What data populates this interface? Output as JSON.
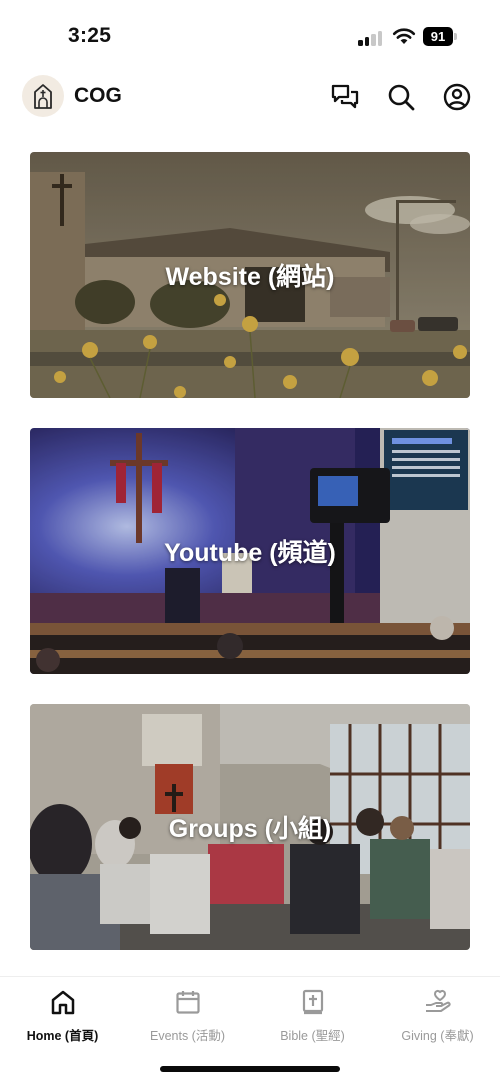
{
  "status_bar": {
    "time": "3:25",
    "battery": "91"
  },
  "header": {
    "title": "COG",
    "icons": [
      "church-logo-icon",
      "chat-icon",
      "search-icon",
      "account-icon"
    ]
  },
  "cards": [
    {
      "label": "Website (網站)",
      "name": "website"
    },
    {
      "label": "Youtube (頻道)",
      "name": "youtube"
    },
    {
      "label": "Groups (小組)",
      "name": "groups"
    }
  ],
  "tabs": [
    {
      "label": "Home (首頁)",
      "icon": "home-icon",
      "active": true
    },
    {
      "label": "Events (活動)",
      "icon": "calendar-icon",
      "active": false
    },
    {
      "label": "Bible (聖經)",
      "icon": "bible-icon",
      "active": false
    },
    {
      "label": "Giving (奉獻)",
      "icon": "giving-icon",
      "active": false
    }
  ],
  "colors": {
    "active_tab": "#111111",
    "inactive_tab": "#9a9a9a",
    "logo_bg": "#f2ebe2"
  }
}
